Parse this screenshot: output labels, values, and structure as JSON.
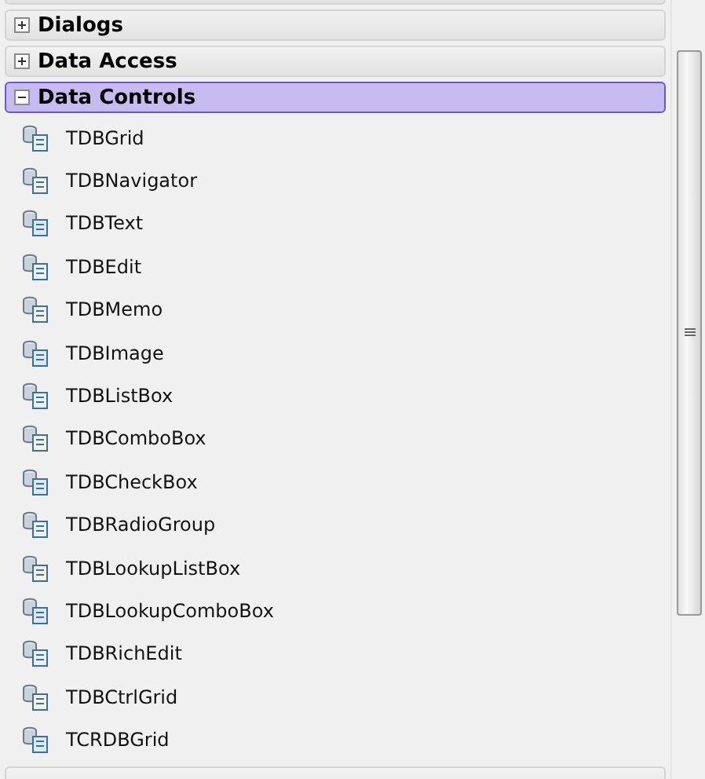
{
  "categories": [
    {
      "label": "Dialogs",
      "expanded": false,
      "selected": false
    },
    {
      "label": "Data Access",
      "expanded": false,
      "selected": false
    },
    {
      "label": "Data Controls",
      "expanded": true,
      "selected": true,
      "items": [
        {
          "label": "TDBGrid"
        },
        {
          "label": "TDBNavigator"
        },
        {
          "label": "TDBText"
        },
        {
          "label": "TDBEdit"
        },
        {
          "label": "TDBMemo"
        },
        {
          "label": "TDBImage"
        },
        {
          "label": "TDBListBox"
        },
        {
          "label": "TDBComboBox"
        },
        {
          "label": "TDBCheckBox"
        },
        {
          "label": "TDBRadioGroup"
        },
        {
          "label": "TDBLookupListBox"
        },
        {
          "label": "TDBLookupComboBox"
        },
        {
          "label": "TDBRichEdit"
        },
        {
          "label": "TDBCtrlGrid"
        },
        {
          "label": "TCRDBGrid"
        }
      ]
    }
  ]
}
